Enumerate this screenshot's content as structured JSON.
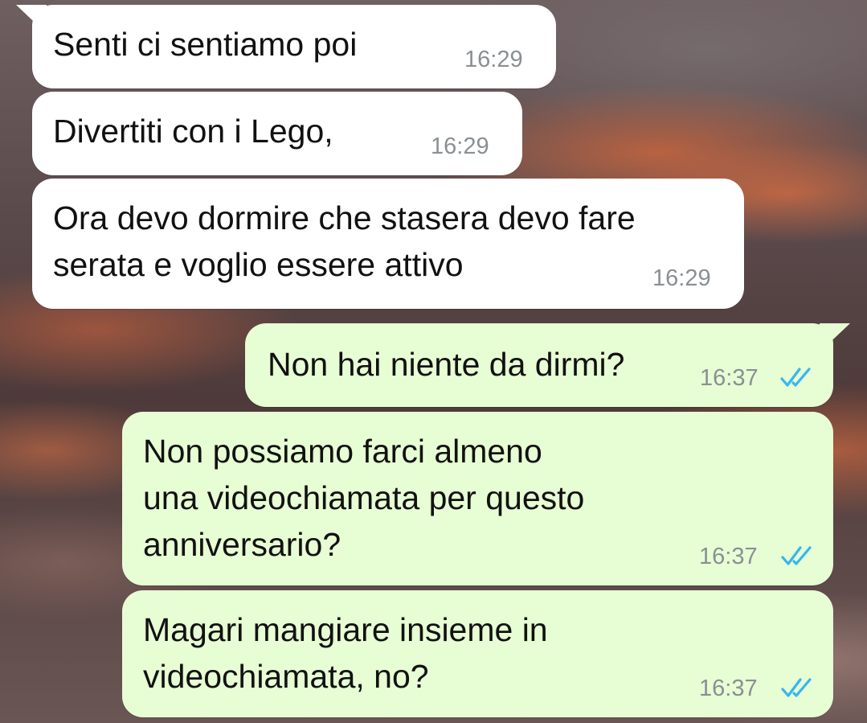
{
  "messages": [
    {
      "id": 1,
      "direction": "incoming",
      "text": "Senti ci sentiamo poi",
      "time": "16:29"
    },
    {
      "id": 2,
      "direction": "incoming",
      "text": "Divertiti con i Lego,",
      "time": "16:29"
    },
    {
      "id": 3,
      "direction": "incoming",
      "lines": [
        "Ora devo dormire che stasera devo fare",
        "serata e voglio essere attivo"
      ],
      "time": "16:29"
    },
    {
      "id": 4,
      "direction": "outgoing",
      "text": "Non hai niente da dirmi?",
      "time": "16:37",
      "status_icon": "double-check-read-icon"
    },
    {
      "id": 5,
      "direction": "outgoing",
      "lines": [
        "Non possiamo farci almeno",
        "una videochiamata per questo",
        "anniversario?"
      ],
      "time": "16:37",
      "status_icon": "double-check-read-icon"
    },
    {
      "id": 6,
      "direction": "outgoing",
      "lines": [
        "Magari mangiare insieme in",
        "videochiamata, no?"
      ],
      "time": "16:37",
      "status_icon": "double-check-read-icon"
    }
  ],
  "colors": {
    "incoming_bubble": "#ffffff",
    "outgoing_bubble": "#e7fdd3",
    "timestamp": "#8a8f93",
    "read_ticks": "#34b7f1"
  }
}
